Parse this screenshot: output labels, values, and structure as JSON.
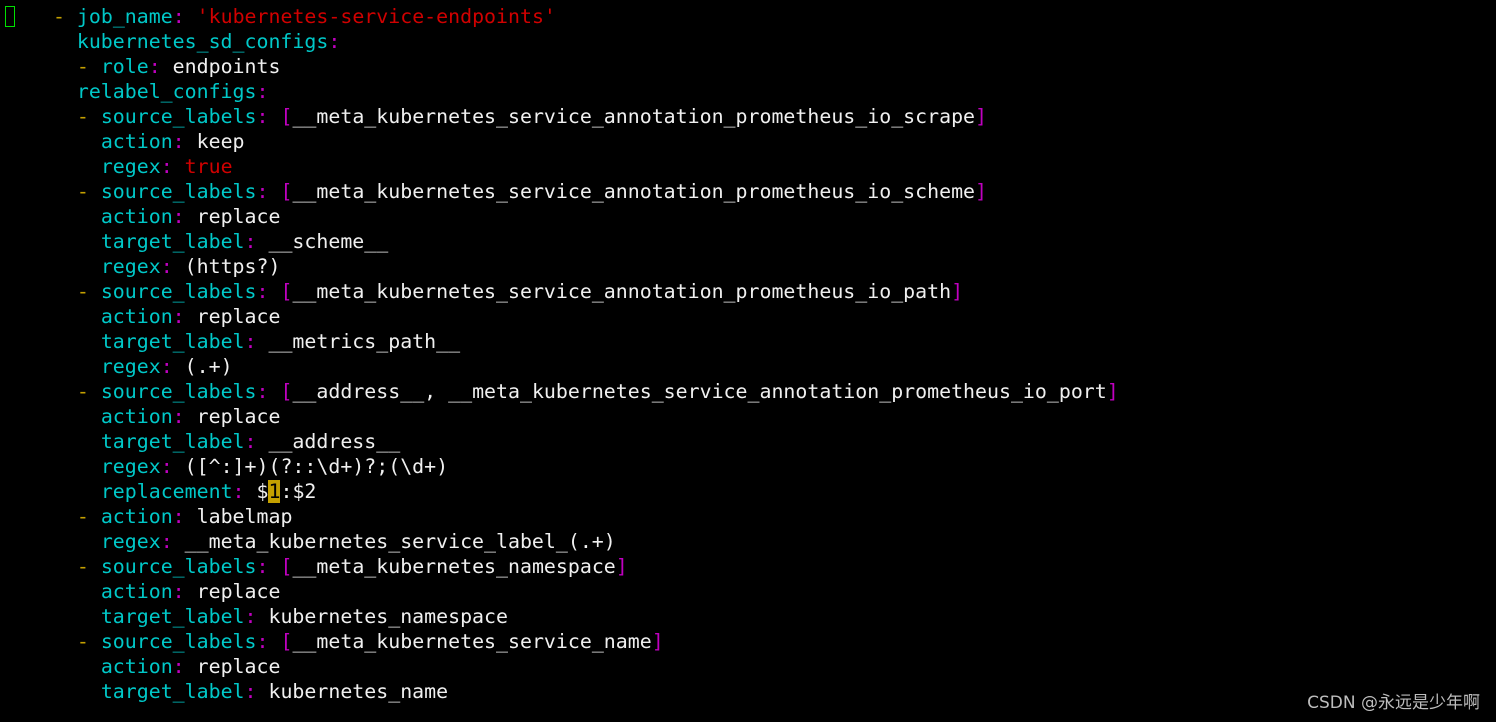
{
  "colors": {
    "dash": "#c4a000",
    "key": "#00c8c8",
    "colon": "#c000c0",
    "value": "#f0f0f0",
    "string": "#d00000",
    "bracket": "#c000c0",
    "cursor": "#00e000"
  },
  "lines": [
    {
      "indent": 3,
      "tokens": [
        [
          "dash",
          "- "
        ],
        [
          "key",
          "job_name"
        ],
        [
          "colon",
          ": "
        ],
        [
          "str",
          "'kubernetes-service-endpoints'"
        ]
      ]
    },
    {
      "indent": 6,
      "tokens": [
        [
          "key",
          "kubernetes_sd_configs"
        ],
        [
          "colon",
          ":"
        ]
      ]
    },
    {
      "indent": 6,
      "tokens": [
        [
          "dash",
          "- "
        ],
        [
          "key",
          "role"
        ],
        [
          "colon",
          ": "
        ],
        [
          "val",
          "endpoints"
        ]
      ]
    },
    {
      "indent": 6,
      "tokens": [
        [
          "key",
          "relabel_configs"
        ],
        [
          "colon",
          ":"
        ]
      ]
    },
    {
      "indent": 6,
      "tokens": [
        [
          "dash",
          "- "
        ],
        [
          "key",
          "source_labels"
        ],
        [
          "colon",
          ": "
        ],
        [
          "bracket",
          "["
        ],
        [
          "val",
          "__meta_kubernetes_service_annotation_prometheus_io_scrape"
        ],
        [
          "bracket",
          "]"
        ]
      ]
    },
    {
      "indent": 8,
      "tokens": [
        [
          "key",
          "action"
        ],
        [
          "colon",
          ": "
        ],
        [
          "val",
          "keep"
        ]
      ]
    },
    {
      "indent": 8,
      "tokens": [
        [
          "key",
          "regex"
        ],
        [
          "colon",
          ": "
        ],
        [
          "str",
          "true"
        ]
      ]
    },
    {
      "indent": 6,
      "tokens": [
        [
          "dash",
          "- "
        ],
        [
          "key",
          "source_labels"
        ],
        [
          "colon",
          ": "
        ],
        [
          "bracket",
          "["
        ],
        [
          "val",
          "__meta_kubernetes_service_annotation_prometheus_io_scheme"
        ],
        [
          "bracket",
          "]"
        ]
      ]
    },
    {
      "indent": 8,
      "tokens": [
        [
          "key",
          "action"
        ],
        [
          "colon",
          ": "
        ],
        [
          "val",
          "replace"
        ]
      ]
    },
    {
      "indent": 8,
      "tokens": [
        [
          "key",
          "target_label"
        ],
        [
          "colon",
          ": "
        ],
        [
          "val",
          "__scheme__"
        ]
      ]
    },
    {
      "indent": 8,
      "tokens": [
        [
          "key",
          "regex"
        ],
        [
          "colon",
          ": "
        ],
        [
          "val",
          "(https?)"
        ]
      ]
    },
    {
      "indent": 6,
      "tokens": [
        [
          "dash",
          "- "
        ],
        [
          "key",
          "source_labels"
        ],
        [
          "colon",
          ": "
        ],
        [
          "bracket",
          "["
        ],
        [
          "val",
          "__meta_kubernetes_service_annotation_prometheus_io_path"
        ],
        [
          "bracket",
          "]"
        ]
      ]
    },
    {
      "indent": 8,
      "tokens": [
        [
          "key",
          "action"
        ],
        [
          "colon",
          ": "
        ],
        [
          "val",
          "replace"
        ]
      ]
    },
    {
      "indent": 8,
      "tokens": [
        [
          "key",
          "target_label"
        ],
        [
          "colon",
          ": "
        ],
        [
          "val",
          "__metrics_path__"
        ]
      ]
    },
    {
      "indent": 8,
      "tokens": [
        [
          "key",
          "regex"
        ],
        [
          "colon",
          ": "
        ],
        [
          "val",
          "(.+)"
        ]
      ]
    },
    {
      "indent": 6,
      "tokens": [
        [
          "dash",
          "- "
        ],
        [
          "key",
          "source_labels"
        ],
        [
          "colon",
          ": "
        ],
        [
          "bracket",
          "["
        ],
        [
          "val",
          "__address__, __meta_kubernetes_service_annotation_prometheus_io_port"
        ],
        [
          "bracket",
          "]"
        ]
      ]
    },
    {
      "indent": 8,
      "tokens": [
        [
          "key",
          "action"
        ],
        [
          "colon",
          ": "
        ],
        [
          "val",
          "replace"
        ]
      ]
    },
    {
      "indent": 8,
      "tokens": [
        [
          "key",
          "target_label"
        ],
        [
          "colon",
          ": "
        ],
        [
          "val",
          "__address__"
        ]
      ]
    },
    {
      "indent": 8,
      "tokens": [
        [
          "key",
          "regex"
        ],
        [
          "colon",
          ": "
        ],
        [
          "val",
          "([^:]+)(?::\\d+)?;(\\d+)"
        ]
      ]
    },
    {
      "indent": 8,
      "tokens": [
        [
          "key",
          "replacement"
        ],
        [
          "colon",
          ": "
        ],
        [
          "val",
          "$"
        ],
        [
          "hl",
          "1"
        ],
        [
          "val",
          ":$2"
        ]
      ]
    },
    {
      "indent": 6,
      "tokens": [
        [
          "dash",
          "- "
        ],
        [
          "key",
          "action"
        ],
        [
          "colon",
          ": "
        ],
        [
          "val",
          "labelmap"
        ]
      ]
    },
    {
      "indent": 8,
      "tokens": [
        [
          "key",
          "regex"
        ],
        [
          "colon",
          ": "
        ],
        [
          "val",
          "__meta_kubernetes_service_label_(.+)"
        ]
      ]
    },
    {
      "indent": 6,
      "tokens": [
        [
          "dash",
          "- "
        ],
        [
          "key",
          "source_labels"
        ],
        [
          "colon",
          ": "
        ],
        [
          "bracket",
          "["
        ],
        [
          "val",
          "__meta_kubernetes_namespace"
        ],
        [
          "bracket",
          "]"
        ]
      ]
    },
    {
      "indent": 8,
      "tokens": [
        [
          "key",
          "action"
        ],
        [
          "colon",
          ": "
        ],
        [
          "val",
          "replace"
        ]
      ]
    },
    {
      "indent": 8,
      "tokens": [
        [
          "key",
          "target_label"
        ],
        [
          "colon",
          ": "
        ],
        [
          "val",
          "kubernetes_namespace"
        ]
      ]
    },
    {
      "indent": 6,
      "tokens": [
        [
          "dash",
          "- "
        ],
        [
          "key",
          "source_labels"
        ],
        [
          "colon",
          ": "
        ],
        [
          "bracket",
          "["
        ],
        [
          "val",
          "__meta_kubernetes_service_name"
        ],
        [
          "bracket",
          "]"
        ]
      ]
    },
    {
      "indent": 8,
      "tokens": [
        [
          "key",
          "action"
        ],
        [
          "colon",
          ": "
        ],
        [
          "val",
          "replace"
        ]
      ]
    },
    {
      "indent": 8,
      "tokens": [
        [
          "key",
          "target_label"
        ],
        [
          "colon",
          ": "
        ],
        [
          "val",
          "kubernetes_name"
        ]
      ]
    }
  ],
  "watermark": "CSDN @永远是少年啊"
}
